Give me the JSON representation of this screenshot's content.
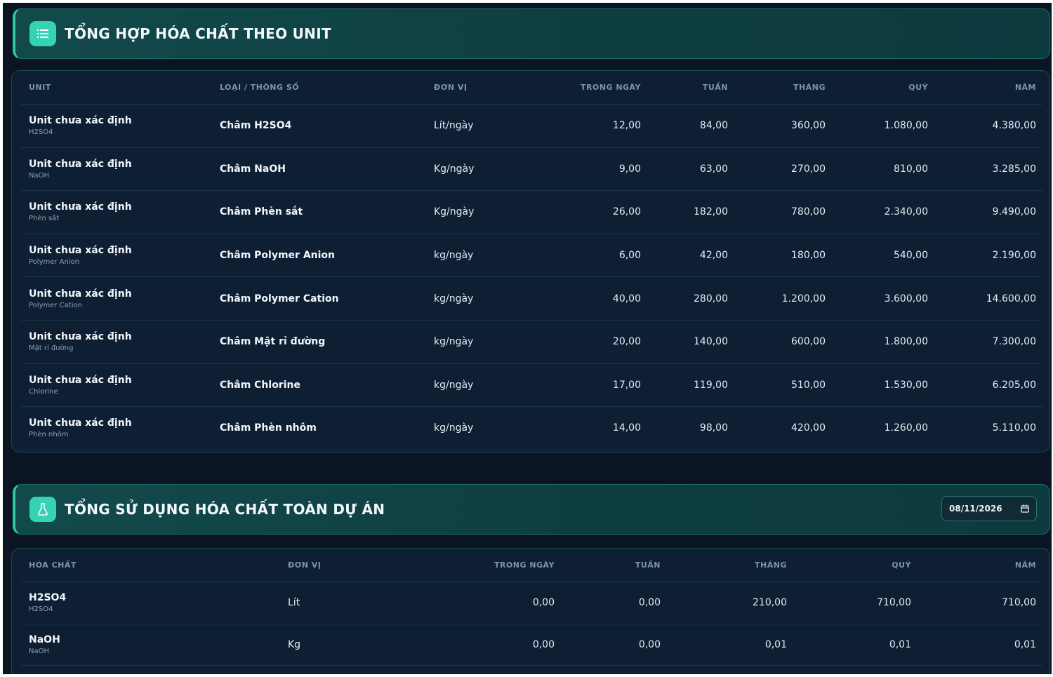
{
  "section1": {
    "title": "TỔNG HỢP HÓA CHẤT THEO UNIT",
    "columns": [
      "UNIT",
      "LOẠI / THÔNG SỐ",
      "ĐƠN VỊ",
      "TRONG NGÀY",
      "TUẦN",
      "THÁNG",
      "QUÝ",
      "NĂM"
    ],
    "rows": [
      {
        "unit": "Unit chưa xác định",
        "sub": "H2SO4",
        "type": "Châm H2SO4",
        "uom": "Lít/ngày",
        "day": "12,00",
        "week": "84,00",
        "month": "360,00",
        "quarter": "1.080,00",
        "year": "4.380,00"
      },
      {
        "unit": "Unit chưa xác định",
        "sub": "NaOH",
        "type": "Châm NaOH",
        "uom": "Kg/ngày",
        "day": "9,00",
        "week": "63,00",
        "month": "270,00",
        "quarter": "810,00",
        "year": "3.285,00"
      },
      {
        "unit": "Unit chưa xác định",
        "sub": "Phèn sắt",
        "type": "Châm Phèn sắt",
        "uom": "Kg/ngày",
        "day": "26,00",
        "week": "182,00",
        "month": "780,00",
        "quarter": "2.340,00",
        "year": "9.490,00"
      },
      {
        "unit": "Unit chưa xác định",
        "sub": "Polymer Anion",
        "type": "Châm Polymer Anion",
        "uom": "kg/ngày",
        "day": "6,00",
        "week": "42,00",
        "month": "180,00",
        "quarter": "540,00",
        "year": "2.190,00"
      },
      {
        "unit": "Unit chưa xác định",
        "sub": "Polymer Cation",
        "type": "Châm Polymer Cation",
        "uom": "kg/ngày",
        "day": "40,00",
        "week": "280,00",
        "month": "1.200,00",
        "quarter": "3.600,00",
        "year": "14.600,00"
      },
      {
        "unit": "Unit chưa xác định",
        "sub": "Mật rỉ đường",
        "type": "Châm Mật rỉ đường",
        "uom": "kg/ngày",
        "day": "20,00",
        "week": "140,00",
        "month": "600,00",
        "quarter": "1.800,00",
        "year": "7.300,00"
      },
      {
        "unit": "Unit chưa xác định",
        "sub": "Chlorine",
        "type": "Châm Chlorine",
        "uom": "kg/ngày",
        "day": "17,00",
        "week": "119,00",
        "month": "510,00",
        "quarter": "1.530,00",
        "year": "6.205,00"
      },
      {
        "unit": "Unit chưa xác định",
        "sub": "Phèn nhôm",
        "type": "Châm Phèn nhôm",
        "uom": "kg/ngày",
        "day": "14,00",
        "week": "98,00",
        "month": "420,00",
        "quarter": "1.260,00",
        "year": "5.110,00"
      }
    ]
  },
  "section2": {
    "title": "TỔNG SỬ DỤNG HÓA CHẤT TOÀN DỰ ÁN",
    "date": "08/11/2026",
    "columns": [
      "HÓA CHẤT",
      "ĐƠN VỊ",
      "TRONG NGÀY",
      "TUẦN",
      "THÁNG",
      "QUÝ",
      "NĂM"
    ],
    "rows": [
      {
        "name": "H2SO4",
        "sub": "H2SO4",
        "uom": "Lít",
        "day": "0,00",
        "week": "0,00",
        "month": "210,00",
        "quarter": "710,00",
        "year": "710,00"
      },
      {
        "name": "NaOH",
        "sub": "NaOH",
        "uom": "Kg",
        "day": "0,00",
        "week": "0,00",
        "month": "0,01",
        "quarter": "0,01",
        "year": "0,01"
      }
    ]
  },
  "icons": {
    "section1": "list-icon",
    "section2": "flask-icon",
    "date": "calendar-icon"
  },
  "colors": {
    "background": "#0a1422",
    "accent": "#35d3b3",
    "header": "#124a4c"
  }
}
